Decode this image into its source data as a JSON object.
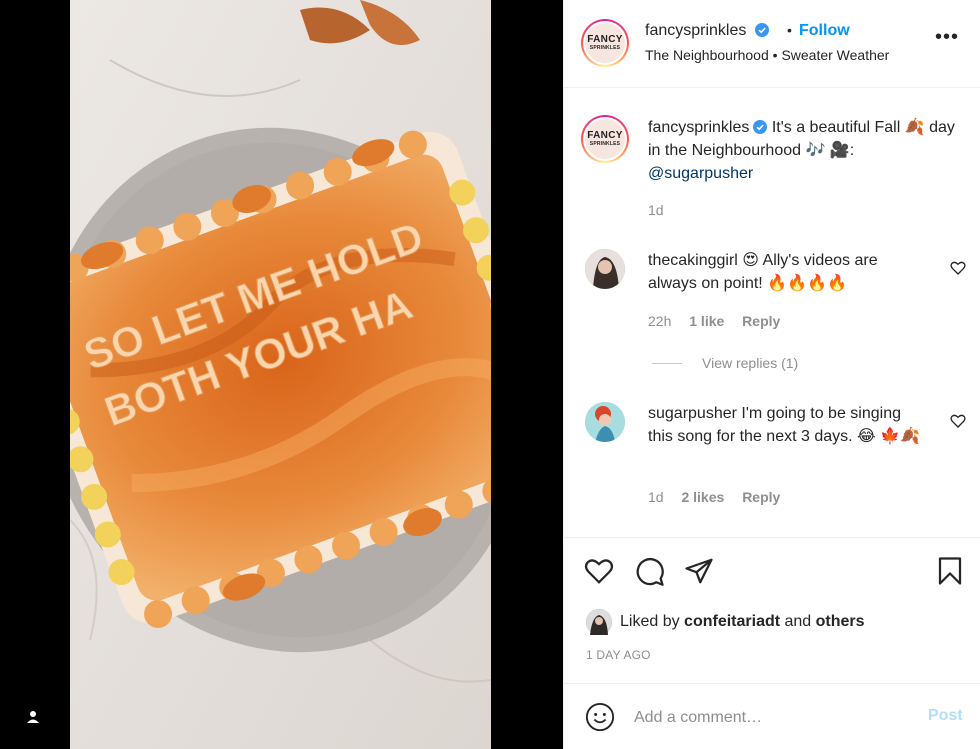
{
  "post": {
    "author": "fancysprinkles",
    "avatar_text_line1": "FANCY",
    "avatar_text_line2": "SPRINKLES",
    "follow_label": "Follow",
    "dot": "•",
    "location": "The Neighbourhood • Sweater Weather",
    "more_label": "•••"
  },
  "media": {
    "cake_text_line1": "SO LET ME HOLD",
    "cake_text_line2": "BOTH YOUR HA"
  },
  "caption": {
    "username": "fancysprinkles",
    "text_part1": " It's a beautiful Fall 🍂 day in the Neighbourhood 🎶 🎥:",
    "mention": "@sugarpusher",
    "time": "1d"
  },
  "comments": [
    {
      "username": "thecakinggirl",
      "text": " 😍 Ally's videos are always on point! 🔥🔥🔥🔥",
      "time": "22h",
      "likes": "1 like",
      "reply": "Reply",
      "view_replies": "View replies (1)"
    },
    {
      "username": "sugarpusher",
      "text": " I'm going to be singing this song for the next 3 days. 😂 🍁🍂",
      "time": "1d",
      "likes": "2 likes",
      "reply": "Reply"
    }
  ],
  "likes": {
    "prefix": "Liked by ",
    "user": "confeitariadt",
    "conj": " and ",
    "others": "others",
    "date": "1 DAY AGO"
  },
  "add_comment": {
    "placeholder": "Add a comment…",
    "post_label": "Post"
  },
  "colors": {
    "accent": "#0095f6",
    "mention": "#00376b",
    "muted": "#8e8e8e",
    "post_disabled": "#b2dffc"
  }
}
